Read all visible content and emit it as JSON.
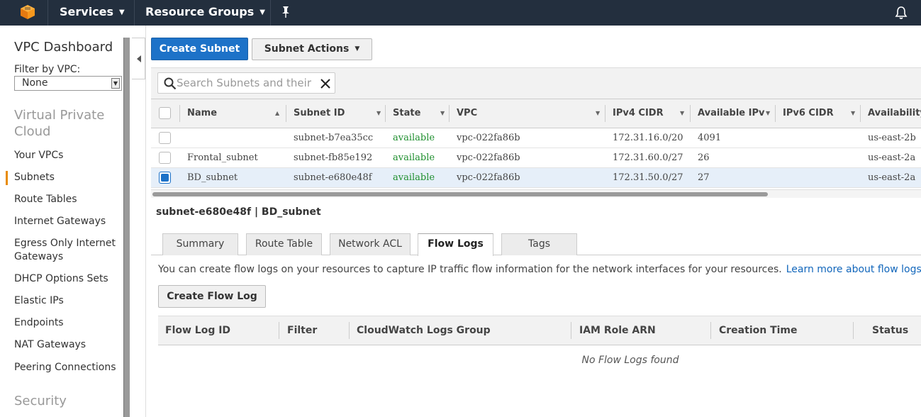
{
  "topnav": {
    "services_label": "Services",
    "resource_groups_label": "Resource Groups"
  },
  "sidebar": {
    "title": "VPC Dashboard",
    "filter_label": "Filter by VPC:",
    "filter_value": "None",
    "section_vpc": "Virtual Private Cloud",
    "items": [
      {
        "label": "Your VPCs"
      },
      {
        "label": "Subnets"
      },
      {
        "label": "Route Tables"
      },
      {
        "label": "Internet Gateways"
      },
      {
        "label": "Egress Only Internet Gateways"
      },
      {
        "label": "DHCP Options Sets"
      },
      {
        "label": "Elastic IPs"
      },
      {
        "label": "Endpoints"
      },
      {
        "label": "NAT Gateways"
      },
      {
        "label": "Peering Connections"
      }
    ],
    "section_security": "Security"
  },
  "toolbar": {
    "create_label": "Create Subnet",
    "actions_label": "Subnet Actions"
  },
  "search": {
    "placeholder": "Search Subnets and their"
  },
  "table": {
    "columns": [
      "Name",
      "Subnet ID",
      "State",
      "VPC",
      "IPv4 CIDR",
      "Available IPv",
      "IPv6 CIDR",
      "Availability"
    ],
    "rows": [
      {
        "name": "",
        "subnet_id": "subnet-b7ea35cc",
        "state": "available",
        "vpc": "vpc-022fa86b",
        "ipv4": "172.31.16.0/20",
        "available": "4091",
        "ipv6": "",
        "az": "us-east-2b",
        "selected": false
      },
      {
        "name": "Frontal_subnet",
        "subnet_id": "subnet-fb85e192",
        "state": "available",
        "vpc": "vpc-022fa86b",
        "ipv4": "172.31.60.0/27",
        "available": "26",
        "ipv6": "",
        "az": "us-east-2a",
        "selected": false
      },
      {
        "name": "BD_subnet",
        "subnet_id": "subnet-e680e48f",
        "state": "available",
        "vpc": "vpc-022fa86b",
        "ipv4": "172.31.50.0/27",
        "available": "27",
        "ipv6": "",
        "az": "us-east-2a",
        "selected": true
      }
    ]
  },
  "detail": {
    "title": "subnet-e680e48f | BD_subnet",
    "tabs": [
      {
        "label": "Summary"
      },
      {
        "label": "Route Table"
      },
      {
        "label": "Network ACL"
      },
      {
        "label": "Flow Logs"
      },
      {
        "label": "Tags"
      }
    ],
    "active_tab": "Flow Logs",
    "info_text": "You can create flow logs on your resources to capture IP traffic flow information for the network interfaces for your resources.",
    "learn_more": "Learn more about flow logs.",
    "create_flow_log": "Create Flow Log",
    "flow_columns": [
      "Flow Log ID",
      "Filter",
      "CloudWatch Logs Group",
      "IAM Role ARN",
      "Creation Time",
      "Status"
    ],
    "empty_message": "No Flow Logs found"
  },
  "colors": {
    "nav_bg": "#232f3e",
    "primary": "#1d72c8",
    "status_green": "#1e8e2e",
    "active_marker": "#e88b00",
    "link": "#1166bb"
  }
}
